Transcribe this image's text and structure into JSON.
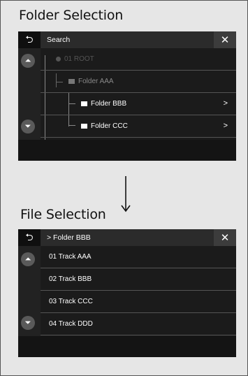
{
  "top": {
    "heading": "Folder Selection",
    "header": {
      "back_icon": "back-arrow-icon",
      "title": "Search",
      "close_label": "✕"
    },
    "rows": [
      {
        "label": "01 ROOT"
      },
      {
        "label": "Folder AAA"
      },
      {
        "label": "Folder BBB",
        "chevron": ">"
      },
      {
        "label": "Folder CCC",
        "chevron": ">"
      }
    ]
  },
  "bottom": {
    "heading": "File Selection",
    "header": {
      "back_icon": "back-arrow-icon",
      "title": "> Folder BBB",
      "close_label": "✕"
    },
    "rows": [
      {
        "label": "01 Track AAA"
      },
      {
        "label": "02 Track BBB"
      },
      {
        "label": "03 Track CCC"
      },
      {
        "label": "04 Track DDD"
      }
    ]
  }
}
